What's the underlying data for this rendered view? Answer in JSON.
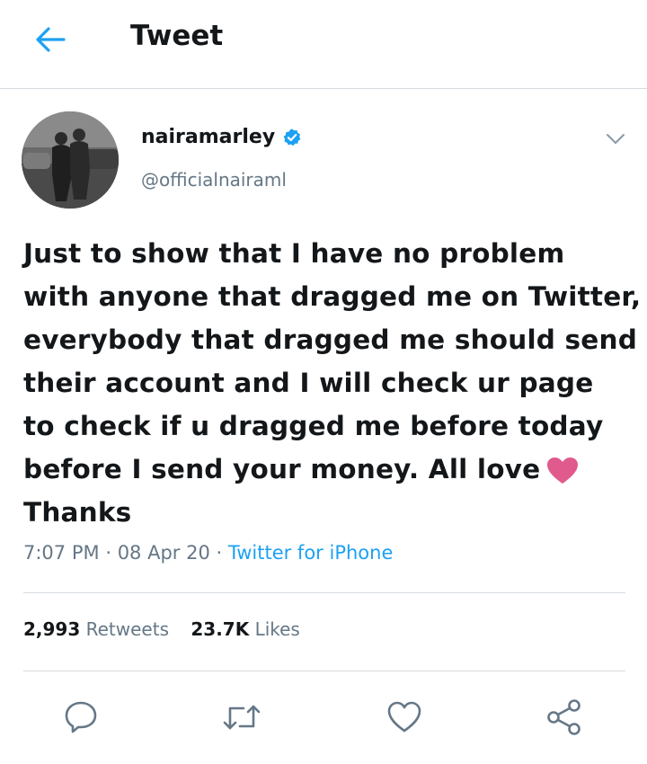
{
  "header": {
    "title": "Tweet"
  },
  "author": {
    "display_name": "nairamarley",
    "handle": "@officialnairaml"
  },
  "tweet": {
    "lines": [
      "Just to show that I have no problem",
      "with anyone that dragged me on Twitter,",
      "everybody that dragged me should send",
      "their account and I will check ur page",
      "to check if u dragged me before today",
      "before I send your money. All love",
      "Thanks"
    ],
    "time": "7:07 PM",
    "date": "08 Apr 20",
    "dot": "·",
    "source": "Twitter for iPhone"
  },
  "stats": {
    "retweets_count": "2,993",
    "retweets_label": "Retweets",
    "likes_count": "23.7K",
    "likes_label": "Likes"
  },
  "colors": {
    "accent": "#1da1f2",
    "text": "#14171a",
    "secondary": "#657786",
    "divider": "#d6dbe0",
    "heart_emoji": "#e05a8e"
  },
  "icons": {
    "back": "arrow-left-icon",
    "verified": "verified-badge-icon",
    "caret": "chevron-down-icon",
    "reply": "reply-icon",
    "retweet": "retweet-icon",
    "like": "heart-icon",
    "share": "share-icon"
  }
}
